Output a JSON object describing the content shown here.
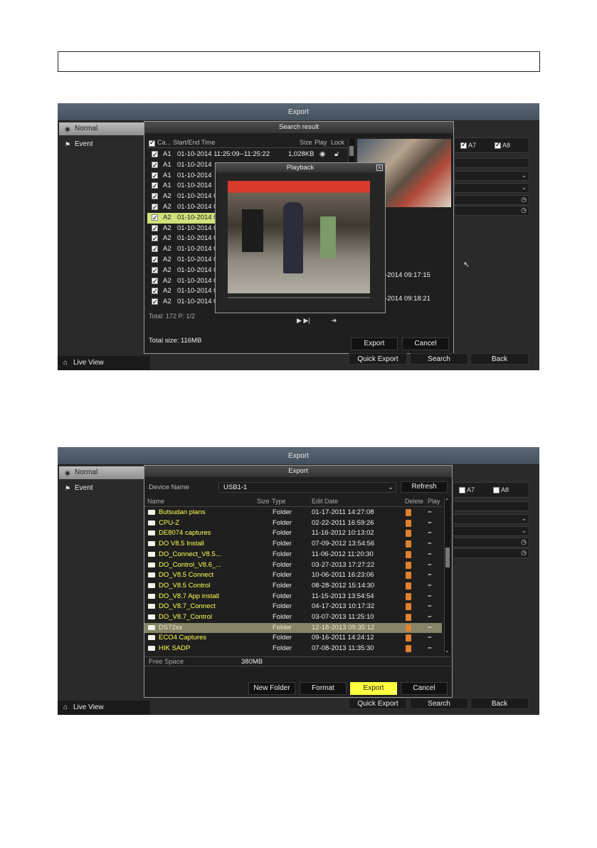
{
  "shot1": {
    "window_title": "Export",
    "sidebar": [
      "Normal",
      "Event"
    ],
    "live_view": "Live View",
    "bottom_buttons": [
      "Quick Export",
      "Search",
      "Back"
    ],
    "camera_checks": [
      {
        "label": "A7",
        "checked": true
      },
      {
        "label": "A8",
        "checked": true
      }
    ],
    "partial_times": [
      "-2014 09:17:15",
      "-2014 09:18:21"
    ],
    "search_result": {
      "title": "Search result",
      "headers": [
        "Ca...",
        "Start/End Time",
        "Size",
        "Play",
        "Lock"
      ],
      "rows": [
        {
          "cam": "A1",
          "time": "01-10-2014 11:25:09--11:25:22",
          "size": "1,028KB"
        },
        {
          "cam": "A1",
          "time": "01-10-2014"
        },
        {
          "cam": "A1",
          "time": "01-10-2014"
        },
        {
          "cam": "A1",
          "time": "01-10-2014"
        },
        {
          "cam": "A2",
          "time": "01-10-2014 0"
        },
        {
          "cam": "A2",
          "time": "01-10-2014 0"
        },
        {
          "cam": "A2",
          "time": "01-10-2014 0",
          "highlight": true
        },
        {
          "cam": "A2",
          "time": "01-10-2014 0"
        },
        {
          "cam": "A2",
          "time": "01-10-2014 0"
        },
        {
          "cam": "A2",
          "time": "01-10-2014 0"
        },
        {
          "cam": "A2",
          "time": "01-10-2014 0"
        },
        {
          "cam": "A2",
          "time": "01-10-2014 0"
        },
        {
          "cam": "A2",
          "time": "01-10-2014 0"
        },
        {
          "cam": "A2",
          "time": "01-10-2014 0"
        },
        {
          "cam": "A2",
          "time": "01-10-2014 0"
        }
      ],
      "total": "Total: 172  P: 1/2",
      "total_size": "Total size: 116MB",
      "export_label": "Export",
      "cancel_label": "Cancel"
    },
    "playback": {
      "title": "Playback"
    }
  },
  "shot2": {
    "window_title": "Export",
    "sidebar": [
      "Normal",
      "Event"
    ],
    "live_view": "Live View",
    "bottom_buttons": [
      "Quick Export",
      "Search",
      "Back"
    ],
    "camera_checks": [
      {
        "label": "A7",
        "checked": false
      },
      {
        "label": "A8",
        "checked": false
      }
    ],
    "dialog": {
      "title": "Export",
      "device_label": "Device Name",
      "device_value": "USB1-1",
      "refresh_label": "Refresh",
      "headers": [
        "Name",
        "Size",
        "Type",
        "Edit Date",
        "Delete",
        "Play"
      ],
      "rows": [
        {
          "name": "Butsudan plans",
          "type": "Folder",
          "date": "01-17-2011 14:27:08"
        },
        {
          "name": "CPU-Z",
          "type": "Folder",
          "date": "02-22-2011 16:59:26"
        },
        {
          "name": "DE8074 captures",
          "type": "Folder",
          "date": "11-16-2012 10:13:02"
        },
        {
          "name": "DO V8.5 Install",
          "type": "Folder",
          "date": "07-09-2012 13:54:56"
        },
        {
          "name": "DO_Connect_V8.5...",
          "type": "Folder",
          "date": "11-06-2012 11:20:30"
        },
        {
          "name": "DO_Control_V8.6_...",
          "type": "Folder",
          "date": "03-27-2013 17:27:22"
        },
        {
          "name": "DO_V8.5 Connect",
          "type": "Folder",
          "date": "10-06-2011 16:23:06"
        },
        {
          "name": "DO_V8.5 Control",
          "type": "Folder",
          "date": "08-28-2012 15:14:30"
        },
        {
          "name": "DO_V8.7 App install",
          "type": "Folder",
          "date": "11-15-2013 13:54:54"
        },
        {
          "name": "DO_V8.7_Connect",
          "type": "Folder",
          "date": "04-17-2013 10:17:32"
        },
        {
          "name": "DO_V8.7_Control",
          "type": "Folder",
          "date": "03-07-2013 11:25:10"
        },
        {
          "name": "DS72xx",
          "type": "Folder",
          "date": "12-18-2013 09:35:12",
          "highlight": true
        },
        {
          "name": "ECO4 Captures",
          "type": "Folder",
          "date": "09-16-2011 14:24:12"
        },
        {
          "name": "HIK SADP",
          "type": "Folder",
          "date": "07-08-2013 11:35:30"
        }
      ],
      "free_space_label": "Free Space",
      "free_space_value": "380MB",
      "buttons": [
        "New Folder",
        "Format",
        "Export",
        "Cancel"
      ]
    }
  }
}
